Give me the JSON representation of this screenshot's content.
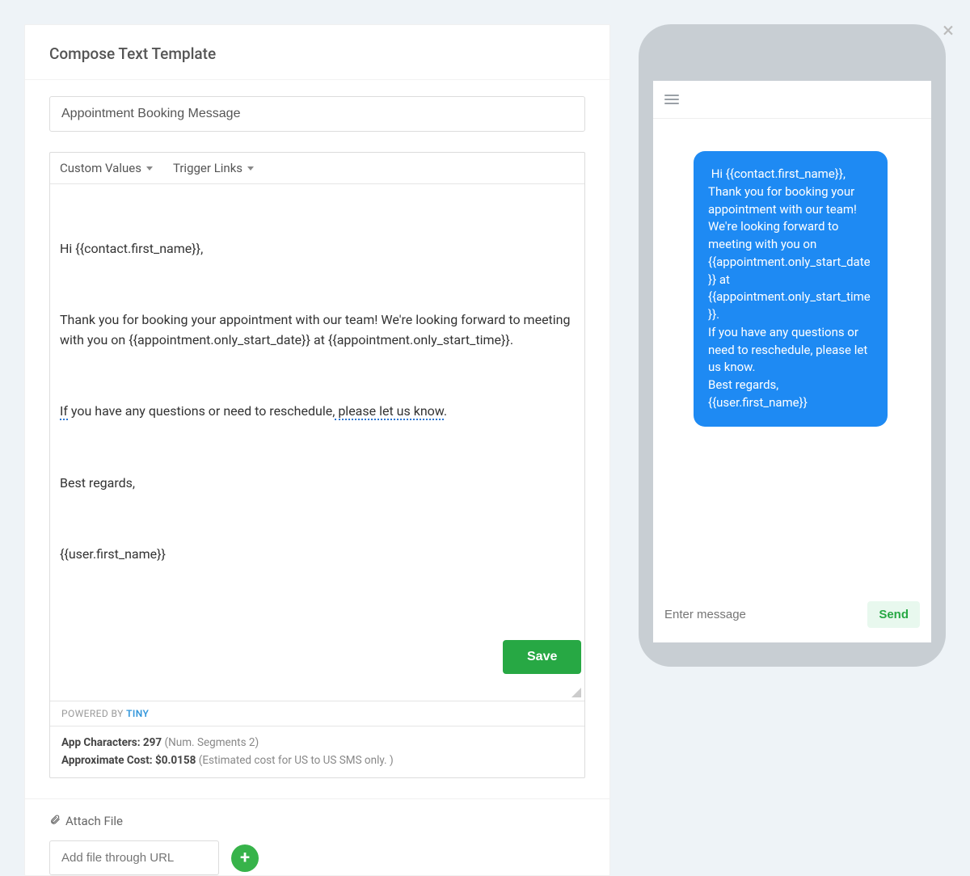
{
  "header": {
    "title": "Compose Text Template"
  },
  "template": {
    "name_value": "Appointment Booking Message",
    "toolbar": {
      "custom_values": "Custom Values",
      "trigger_links": "Trigger Links"
    },
    "body_p1": "Hi {{contact.first_name}},",
    "body_p2_a": "Thank you for booking your appointment with our team! ",
    "body_p2_b": "We're",
    "body_p2_c": " looking forward to meeting with you on {{appointment.only_start_date}} at {{appointment.only_start_time}}.",
    "body_p3_a": "If",
    "body_p3_b": " you have any questions or need to reschedule,",
    "body_p3_c": " please let us know",
    "body_p3_d": ".",
    "body_p4": "Best regards,",
    "body_p5": "{{user.first_name}}"
  },
  "powered": {
    "prefix": "POWERED BY ",
    "brand": "TINY"
  },
  "stats": {
    "chars_label": "App Characters: ",
    "chars_value": "297",
    "segments": " (Num. Segments 2)",
    "cost_label": "Approximate Cost: ",
    "cost_value": "$0.0158",
    "cost_note": " (Estimated cost for US to US SMS only. )"
  },
  "attach": {
    "label": "Attach File",
    "url_placeholder": "Add file through URL"
  },
  "save_label": "Save",
  "preview": {
    "message": " Hi {{contact.first_name}},\nThank you for booking your appointment with our team! We're looking forward to meeting with you on {{appointment.only_start_date}} at {{appointment.only_start_time}}.\nIf you have any questions or need to reschedule, please let us know.\nBest regards,\n{{user.first_name}}",
    "input_placeholder": "Enter message",
    "send_label": "Send"
  }
}
